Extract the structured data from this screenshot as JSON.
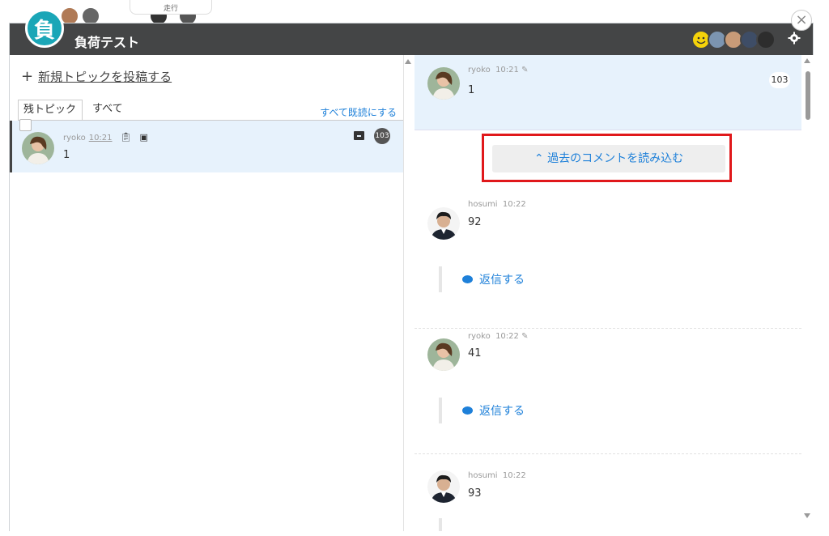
{
  "background": {
    "chip_text": "走行"
  },
  "room": {
    "badge": "負",
    "title": "負荷テスト",
    "close": "×"
  },
  "left": {
    "new_topic_plus": "+",
    "new_topic_label": "新規トピックを投稿する",
    "tabs": [
      {
        "label": "残トピック"
      },
      {
        "label": "すべて"
      }
    ],
    "mark_all_read": "すべて既読にする",
    "topic": {
      "author": "ryoko",
      "time": "10:21",
      "body": "1",
      "count": "103"
    }
  },
  "right": {
    "parent": {
      "author": "ryoko",
      "time": "10:21",
      "body": "1",
      "reply_count": "103"
    },
    "load_more_label": "過去のコメントを読み込む",
    "comments": [
      {
        "author": "hosumi",
        "time": "10:22",
        "body": "92",
        "reply_label": "返信する"
      },
      {
        "author": "ryoko",
        "time": "10:22",
        "body": "41",
        "reply_label": "返信する"
      },
      {
        "author": "hosumi",
        "time": "10:22",
        "body": "93"
      }
    ]
  },
  "colors": {
    "titlebar": "#444546",
    "accent": "#1e80d9",
    "badge": "#1aa6b7",
    "highlight": "#e0181b",
    "selected_row": "#e7f2fc"
  }
}
